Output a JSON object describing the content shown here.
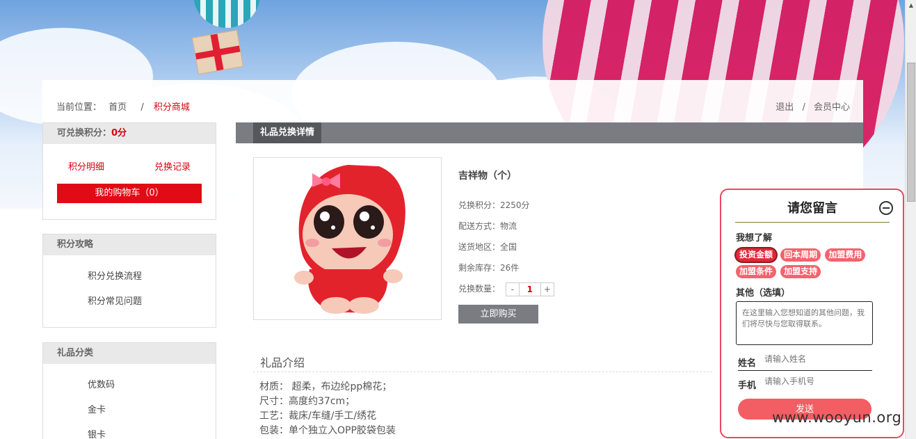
{
  "breadcrumb": {
    "prefix": "当前位置：",
    "home": "首页",
    "sep": "/",
    "current": "积分商城"
  },
  "user_links": {
    "logout": "退出",
    "sep": "/",
    "member_center": "会员中心"
  },
  "points_box": {
    "label": "可兑换积分：",
    "value": "0分",
    "detail_link": "积分明细",
    "history_link": "兑换记录",
    "cart_button": "我的购物车（0）"
  },
  "guide_box": {
    "title": "积分攻略",
    "items": [
      "积分兑换流程",
      "积分常见问题"
    ]
  },
  "category_box": {
    "title": "礼品分类",
    "items": [
      "优数码",
      "金卡",
      "银卡"
    ]
  },
  "detail": {
    "tab": "礼品兑换详情",
    "name": "吉祥物（个）",
    "points": "兑换积分：2250分",
    "delivery": "配送方式：物流",
    "region": "送货地区：全国",
    "stock": "剩余库存：26件",
    "qty_label": "兑换数量：",
    "qty_minus": "-",
    "qty_value": "1",
    "qty_plus": "+",
    "buy_button": "立即购买"
  },
  "intro": {
    "title": "礼品介绍",
    "lines": [
      "材质： 超柔，布边纶pp棉花；",
      "尺寸：高度约37cm；",
      "工艺：裁床/车缝/手工/绣花",
      "包装：单个独立入OPP胶袋包装"
    ]
  },
  "message_panel": {
    "title": "请您留言",
    "want_label": "我想了解",
    "tags": [
      "投资金额",
      "回本周期",
      "加盟费用",
      "加盟条件",
      "加盟支持"
    ],
    "selected_tag": "投资金额",
    "other_label": "其他（选填）",
    "textarea_placeholder": "在这里输入您想知道的其他问题，我们将尽快与您取得联系。",
    "name_label": "姓名",
    "name_placeholder": "请输入姓名",
    "phone_label": "手机",
    "phone_placeholder": "请输入手机号",
    "send_button": "发送"
  },
  "watermark": "www.wooyun.org",
  "colors": {
    "accent_red": "#d8000f",
    "cart_red": "#e00b14",
    "panel_border": "#e9485c",
    "tag_pink": "#f4636d",
    "tab_gray": "#7a7c82"
  }
}
